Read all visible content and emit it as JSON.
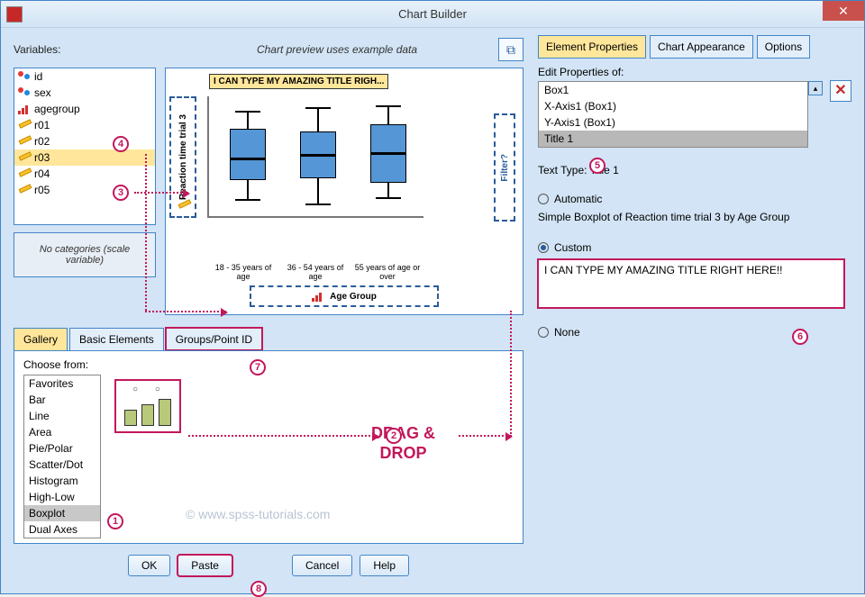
{
  "window": {
    "title": "Chart Builder"
  },
  "left": {
    "variables_label": "Variables:",
    "preview_label": "Chart preview uses example data",
    "variables": [
      {
        "name": "id",
        "icon": "nominal"
      },
      {
        "name": "sex",
        "icon": "nominal"
      },
      {
        "name": "agegroup",
        "icon": "ordinal"
      },
      {
        "name": "r01",
        "icon": "scale"
      },
      {
        "name": "r02",
        "icon": "scale"
      },
      {
        "name": "r03",
        "icon": "scale",
        "selected": true
      },
      {
        "name": "r04",
        "icon": "scale"
      },
      {
        "name": "r05",
        "icon": "scale"
      }
    ],
    "no_categories": "No categories (scale variable)"
  },
  "chart_data": {
    "type": "boxplot",
    "title": "I CAN TYPE MY AMAZING TITLE RIGH...",
    "ylabel": "Reaction time trial 3",
    "xlabel": "Age Group",
    "filter_label": "Filter?",
    "categories": [
      "18 - 35 years of age",
      "36 - 54 years of age",
      "55 years of age or over"
    ],
    "boxes": [
      {
        "low": 20,
        "q1": 40,
        "median": 65,
        "q3": 95,
        "high": 115
      },
      {
        "low": 15,
        "q1": 42,
        "median": 68,
        "q3": 92,
        "high": 118
      },
      {
        "low": 22,
        "q1": 38,
        "median": 70,
        "q3": 100,
        "high": 120
      }
    ]
  },
  "tabs": {
    "gallery": "Gallery",
    "basic": "Basic Elements",
    "groups": "Groups/Point ID"
  },
  "gallery": {
    "choose_label": "Choose from:",
    "types": [
      "Favorites",
      "Bar",
      "Line",
      "Area",
      "Pie/Polar",
      "Scatter/Dot",
      "Histogram",
      "High-Low",
      "Boxplot",
      "Dual Axes"
    ],
    "selected_type": "Boxplot",
    "drag_text_1": "DRAG &",
    "drag_text_2": "DROP"
  },
  "watermark": "© www.spss-tutorials.com",
  "buttons": {
    "ok": "OK",
    "paste": "Paste",
    "cancel": "Cancel",
    "help": "Help"
  },
  "right_tabs": {
    "elem": "Element Properties",
    "appear": "Chart Appearance",
    "opts": "Options"
  },
  "props": {
    "edit_label": "Edit Properties of:",
    "list": [
      "Box1",
      "X-Axis1 (Box1)",
      "Y-Axis1 (Box1)",
      "Title 1"
    ],
    "selected": "Title 1",
    "text_type": "Text Type: Title 1",
    "automatic_label": "Automatic",
    "auto_desc": "Simple Boxplot of Reaction time trial 3 by Age Group",
    "custom_label": "Custom",
    "custom_value": "I CAN TYPE MY AMAZING TITLE RIGHT HERE!!",
    "none_label": "None"
  },
  "callouts": {
    "1": "1",
    "2": "2",
    "3": "3",
    "4": "4",
    "5": "5",
    "6": "6",
    "7": "7",
    "8": "8"
  }
}
